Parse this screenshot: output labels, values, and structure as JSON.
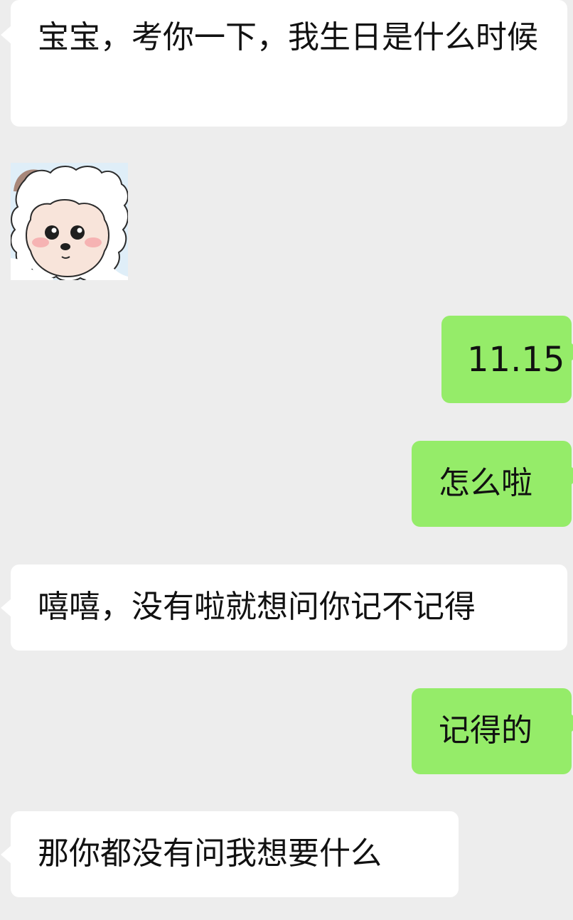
{
  "messages": [
    {
      "sender": "other",
      "type": "text",
      "text": "宝宝，考你一下，我生日是什么时候"
    },
    {
      "sender": "other",
      "type": "sticker",
      "sticker": "cartoon-sheep-face"
    },
    {
      "sender": "self",
      "type": "text",
      "text": "11.15"
    },
    {
      "sender": "self",
      "type": "text",
      "text": "怎么啦"
    },
    {
      "sender": "other",
      "type": "text",
      "text": "嘻嘻，没有啦就想问你记不记得"
    },
    {
      "sender": "self",
      "type": "text",
      "text": "记得的"
    },
    {
      "sender": "other",
      "type": "text",
      "text": "那你都没有问我想要什么"
    }
  ],
  "colors": {
    "background": "#ededed",
    "incoming_bubble": "#ffffff",
    "outgoing_bubble": "#95ec69",
    "text": "#111111"
  }
}
